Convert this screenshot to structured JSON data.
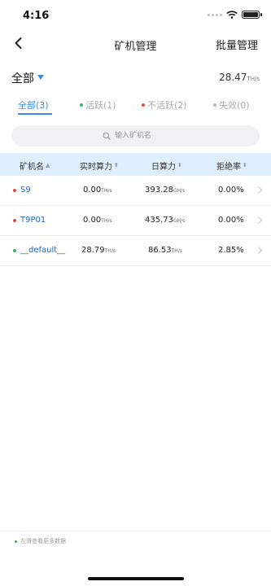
{
  "status_bar": {
    "time": "4:16"
  },
  "nav": {
    "title": "矿机管理",
    "batch_label": "批量管理"
  },
  "summary": {
    "filter_label": "全部",
    "total_hashrate": "28.47",
    "total_unit": "TH/s"
  },
  "tabs": [
    {
      "label": "全部(3)",
      "dot_color": ""
    },
    {
      "label": "活跃(1)",
      "dot_color": "#33b35c"
    },
    {
      "label": "不活跃(2)",
      "dot_color": "#e04646"
    },
    {
      "label": "失效(0)",
      "dot_color": "#b8b8b8"
    }
  ],
  "search": {
    "placeholder": "输入矿机名"
  },
  "table": {
    "headers": [
      "矿机名",
      "实时算力",
      "日算力",
      "拒绝率"
    ],
    "rows": [
      {
        "name": "S9",
        "status_color": "#e04646",
        "realtime": "0.00",
        "realtime_unit": "TH/s",
        "daily": "393.28",
        "daily_unit": "GH/s",
        "reject": "0.00%"
      },
      {
        "name": "T9P01",
        "status_color": "#e04646",
        "realtime": "0.00",
        "realtime_unit": "TH/s",
        "daily": "435.73",
        "daily_unit": "GH/s",
        "reject": "0.00%"
      },
      {
        "name": "__default__",
        "status_color": "#33b35c",
        "realtime": "28.79",
        "realtime_unit": "TH/s",
        "daily": "86.53",
        "daily_unit": "TH/s",
        "reject": "2.85%"
      }
    ]
  },
  "footer": {
    "note": "左滑查看更多数据"
  },
  "colors": {
    "accent": "#3a8ee6",
    "header_bg": "#dfeefc",
    "active": "#33b35c",
    "inactive": "#e04646",
    "invalid": "#b8b8b8"
  }
}
